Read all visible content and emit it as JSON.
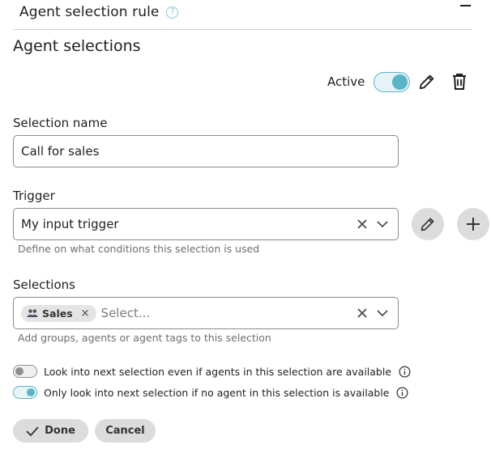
{
  "header": {
    "title": "Agent selection rule",
    "help_icon": "question-circle-icon",
    "collapse_icon": "minus-icon"
  },
  "section": {
    "title": "Agent selections"
  },
  "status": {
    "label": "Active",
    "active": true,
    "accent": "#5ab4c8"
  },
  "actions": {
    "edit_icon": "pencil-icon",
    "delete_icon": "trash-icon"
  },
  "selection_name": {
    "label": "Selection name",
    "value": "Call for sales"
  },
  "trigger": {
    "label": "Trigger",
    "value": "My input trigger",
    "hint": "Define on what conditions this selection is used"
  },
  "selections": {
    "label": "Selections",
    "chip": "Sales",
    "chip_icon": "group-icon",
    "placeholder": "Select...",
    "hint": "Add groups, agents or agent tags to this selection"
  },
  "options": [
    {
      "text": "Look into next selection even if agents in this selection are available",
      "enabled": false
    },
    {
      "text": "Only look into next selection if no agent in this selection is available",
      "enabled": true
    }
  ],
  "buttons": {
    "done": "Done",
    "cancel": "Cancel"
  }
}
